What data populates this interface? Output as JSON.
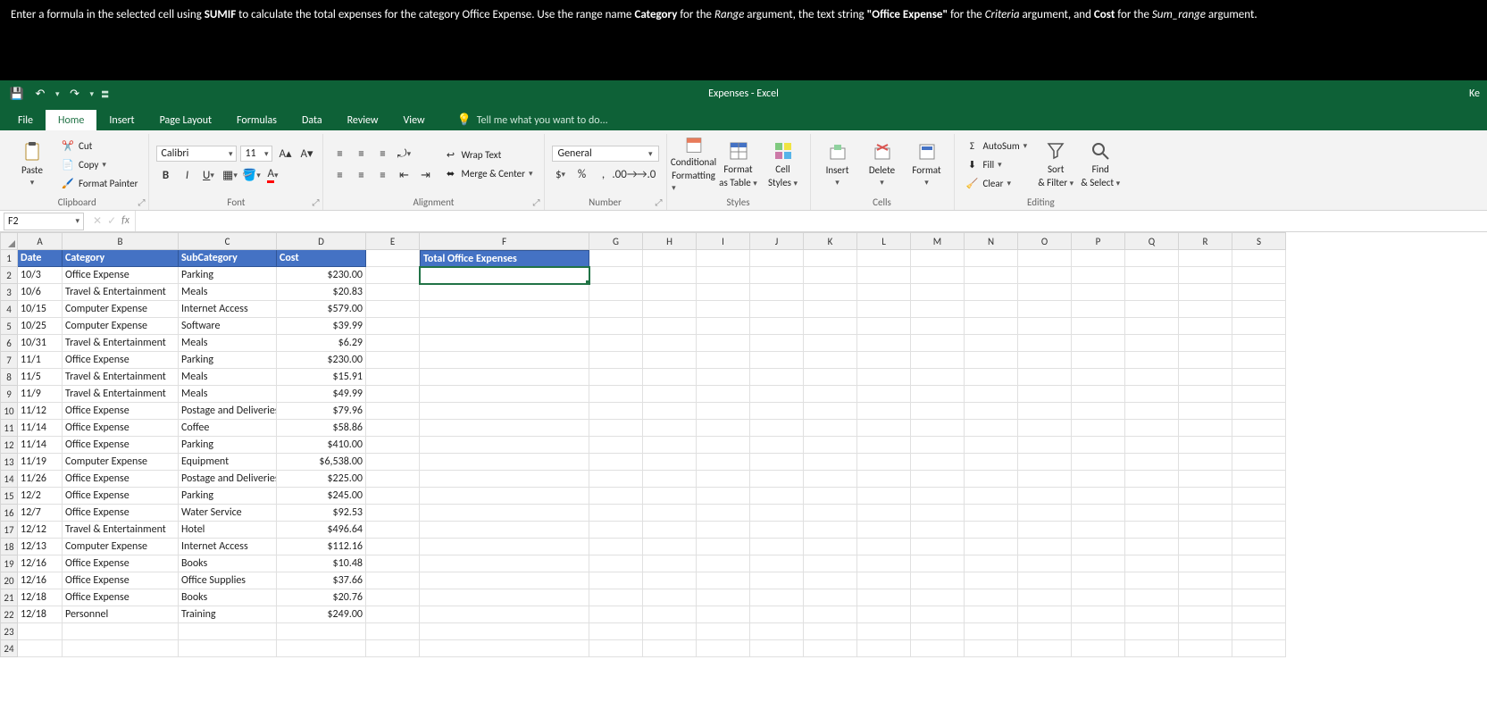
{
  "instruction": {
    "pre": "Enter a formula in the selected cell using ",
    "b1": "SUMIF",
    "mid1": " to calculate the total expenses for the category Office Expense. Use the range name ",
    "b2": "Category",
    "mid2": " for the ",
    "i1": "Range",
    "mid3": " argument, the text string ",
    "b3": "\"Office Expense\"",
    "mid4": " for the ",
    "i2": "Criteria",
    "mid5": " argument, and ",
    "b4": "Cost",
    "mid6": " for the ",
    "i3": "Sum_range",
    "post": " argument."
  },
  "window_title": "Expenses - Excel",
  "right_label": "Ke",
  "tabs": [
    "File",
    "Home",
    "Insert",
    "Page Layout",
    "Formulas",
    "Data",
    "Review",
    "View"
  ],
  "tell_me": "Tell me what you want to do...",
  "clipboard": {
    "paste": "Paste",
    "cut": "Cut",
    "copy": "Copy",
    "fp": "Format Painter",
    "label": "Clipboard"
  },
  "font": {
    "name": "Calibri",
    "size": "11",
    "label": "Font"
  },
  "alignment": {
    "wrap": "Wrap Text",
    "merge": "Merge & Center",
    "label": "Alignment"
  },
  "number": {
    "format": "General",
    "label": "Number"
  },
  "styles": {
    "cf1": "Conditional",
    "cf2": "Formatting",
    "ft1": "Format",
    "ft2": "as Table",
    "cs1": "Cell",
    "cs2": "Styles",
    "label": "Styles"
  },
  "cells": {
    "insert": "Insert",
    "delete": "Delete",
    "format": "Format",
    "label": "Cells"
  },
  "editing": {
    "autosum": "AutoSum",
    "fill": "Fill",
    "clear": "Clear",
    "sort1": "Sort",
    "sort2": "& Filter",
    "find1": "Find",
    "find2": "& Select",
    "label": "Editing"
  },
  "name_box": "F2",
  "columns": [
    "A",
    "B",
    "C",
    "D",
    "E",
    "F",
    "G",
    "H",
    "I",
    "J",
    "K",
    "L",
    "M",
    "N",
    "O",
    "P",
    "Q",
    "R",
    "S"
  ],
  "header_row": {
    "A": "Date",
    "B": "Category",
    "C": "SubCategory",
    "D": "Cost"
  },
  "f1_header": "Total Office Expenses",
  "data_rows": [
    {
      "A": "10/3",
      "B": "Office Expense",
      "C": "Parking",
      "D": "$230.00"
    },
    {
      "A": "10/6",
      "B": "Travel & Entertainment",
      "C": "Meals",
      "D": "$20.83"
    },
    {
      "A": "10/15",
      "B": "Computer Expense",
      "C": "Internet Access",
      "D": "$579.00"
    },
    {
      "A": "10/25",
      "B": "Computer Expense",
      "C": "Software",
      "D": "$39.99"
    },
    {
      "A": "10/31",
      "B": "Travel & Entertainment",
      "C": "Meals",
      "D": "$6.29"
    },
    {
      "A": "11/1",
      "B": "Office Expense",
      "C": "Parking",
      "D": "$230.00"
    },
    {
      "A": "11/5",
      "B": "Travel & Entertainment",
      "C": "Meals",
      "D": "$15.91"
    },
    {
      "A": "11/9",
      "B": "Travel & Entertainment",
      "C": "Meals",
      "D": "$49.99"
    },
    {
      "A": "11/12",
      "B": "Office Expense",
      "C": "Postage and Deliveries",
      "D": "$79.96"
    },
    {
      "A": "11/14",
      "B": "Office Expense",
      "C": "Coffee",
      "D": "$58.86"
    },
    {
      "A": "11/14",
      "B": "Office Expense",
      "C": "Parking",
      "D": "$410.00"
    },
    {
      "A": "11/19",
      "B": "Computer Expense",
      "C": "Equipment",
      "D": "$6,538.00"
    },
    {
      "A": "11/26",
      "B": "Office Expense",
      "C": "Postage and Deliveries",
      "D": "$225.00"
    },
    {
      "A": "12/2",
      "B": "Office Expense",
      "C": "Parking",
      "D": "$245.00"
    },
    {
      "A": "12/7",
      "B": "Office Expense",
      "C": "Water Service",
      "D": "$92.53"
    },
    {
      "A": "12/12",
      "B": "Travel & Entertainment",
      "C": "Hotel",
      "D": "$496.64"
    },
    {
      "A": "12/13",
      "B": "Computer Expense",
      "C": "Internet Access",
      "D": "$112.16"
    },
    {
      "A": "12/16",
      "B": "Office Expense",
      "C": "Books",
      "D": "$10.48"
    },
    {
      "A": "12/16",
      "B": "Office Expense",
      "C": "Office Supplies",
      "D": "$37.66"
    },
    {
      "A": "12/18",
      "B": "Office Expense",
      "C": "Books",
      "D": "$20.76"
    },
    {
      "A": "12/18",
      "B": "Personnel",
      "C": "Training",
      "D": "$249.00"
    }
  ],
  "empty_rows": [
    23,
    24
  ]
}
